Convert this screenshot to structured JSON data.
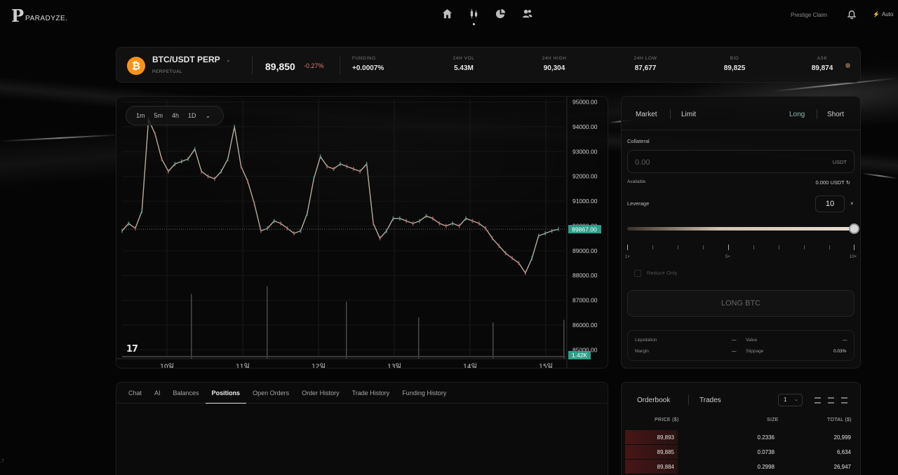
{
  "app": {
    "name": "PARADYZE.",
    "version_fragment": ".7"
  },
  "nav": {
    "icons": [
      "home-icon",
      "candles-icon",
      "pie-chart-icon",
      "users-icon"
    ],
    "active_index": 1,
    "prestige_label": "Prestige Claim",
    "auto_label": "Auto"
  },
  "ticker": {
    "pair": "BTC/USDT PERP",
    "pair_type": "PERPETUAL",
    "coin_symbol": "₿",
    "last_price": "89,850",
    "change": "-0.27%",
    "stats": [
      {
        "label": "FUNDING",
        "value": "+0.0007%"
      },
      {
        "label": "24H VOL",
        "value": "5.43M"
      },
      {
        "label": "24H HIGH",
        "value": "90,304"
      },
      {
        "label": "24H LOW",
        "value": "87,677"
      },
      {
        "label": "BID",
        "value": "89,825"
      },
      {
        "label": "ASK",
        "value": "89,874"
      }
    ]
  },
  "chart": {
    "intervals": [
      "1m",
      "5m",
      "4h",
      "1D"
    ],
    "watermark": "17",
    "current_price_label": "89867.00",
    "volume_label": "1.42K"
  },
  "chart_data": {
    "type": "line",
    "title": "",
    "x_ticks": [
      "10일",
      "11일",
      "12일",
      "13일",
      "14일",
      "15일"
    ],
    "y_ticks": [
      95000,
      94000,
      93000,
      92000,
      91000,
      90000,
      89000,
      88000,
      87000,
      86000,
      85000
    ],
    "ylim": [
      84700,
      95100
    ],
    "series": [
      {
        "values": [
          89800,
          90100,
          89900,
          90600,
          94300,
          93700,
          92700,
          92200,
          92500,
          92600,
          92700,
          93100,
          92200,
          92000,
          91900,
          92200,
          92700,
          94000,
          92400,
          91800,
          90900,
          89800,
          89900,
          90200,
          90100,
          89900,
          89700,
          89800,
          90500,
          91900,
          92800,
          92400,
          92300,
          92500,
          92400,
          92300,
          92200,
          92500,
          90100,
          89500,
          89800,
          90300,
          90300,
          90200,
          90100,
          90200,
          90400,
          90300,
          90100,
          90000,
          90100,
          90000,
          90300,
          90200,
          90100,
          89900,
          89500,
          89200,
          88900,
          88700,
          88500,
          88100,
          88700,
          89600,
          89700,
          89800,
          89867
        ]
      }
    ],
    "volume_spikes": [
      0.25,
      0.28,
      0.22,
      0.16,
      0.14,
      0.15
    ],
    "current_price": 89867,
    "grid": true
  },
  "tabs": {
    "items": [
      "Chat",
      "AI",
      "Balances",
      "Positions",
      "Open Orders",
      "Order History",
      "Trade History",
      "Funding History"
    ],
    "active_index": 3
  },
  "order": {
    "types": [
      "Market",
      "Limit"
    ],
    "sides": [
      "Long",
      "Short"
    ],
    "collateral_label": "Collateral",
    "collateral_placeholder": "0.00",
    "collateral_unit": "USDT",
    "available_label": "Available",
    "available_value": "0.000 USDT",
    "leverage_label": "Leverage",
    "leverage_value": "10",
    "leverage_x": "×",
    "slider_level": 1.0,
    "tick_labels": [
      "1×",
      "5×",
      "10×"
    ],
    "reduce_only_label": "Reduce Only",
    "submit_label": "LONG BTC",
    "info": {
      "liquidation_label": "Liquidation",
      "liquidation_value": "—",
      "margin_label": "Margin",
      "margin_value": "—",
      "value_label": "Value",
      "value_value": "—",
      "slippage_label": "Slippage",
      "slippage_value": "0.03%"
    }
  },
  "orderbook": {
    "tabs": [
      "Orderbook",
      "Trades"
    ],
    "group_value": "1",
    "columns": [
      "PRICE ($)",
      "SIZE",
      "TOTAL ($)"
    ],
    "rows": [
      {
        "price": "89,893",
        "size": "0.2336",
        "total": "20,999"
      },
      {
        "price": "89,885",
        "size": "0.0738",
        "total": "6,634"
      },
      {
        "price": "89,884",
        "size": "0.2998",
        "total": "26,947"
      }
    ]
  }
}
